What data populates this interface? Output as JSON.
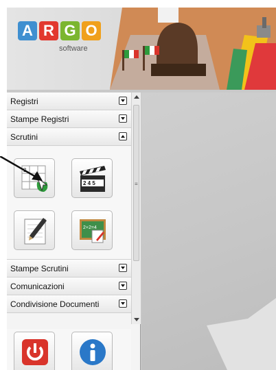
{
  "logo": {
    "letters": [
      "A",
      "R",
      "G",
      "O"
    ],
    "colors": [
      "#3f8fd0",
      "#e2382f",
      "#7bb62f",
      "#f0a01c"
    ],
    "subtitle": "software"
  },
  "sidebar": {
    "sections": [
      {
        "label": "Registri",
        "state": "collapsed"
      },
      {
        "label": "Stampe Registri",
        "state": "collapsed"
      },
      {
        "label": "Scrutini",
        "state": "expanded"
      }
    ],
    "scrutini_icons": [
      "grid-voting-icon",
      "clapperboard-icon",
      "notepad-pen-icon",
      "chalkboard-icon"
    ],
    "sections_after": [
      {
        "label": "Stampe Scrutini",
        "state": "collapsed"
      },
      {
        "label": "Comunicazioni",
        "state": "collapsed"
      },
      {
        "label": "Condivisione Documenti",
        "state": "collapsed"
      }
    ],
    "bottom_icons": [
      "power-icon",
      "info-icon"
    ]
  },
  "clapper_digits": "2 4 5",
  "chalk_text": "2+2=4"
}
